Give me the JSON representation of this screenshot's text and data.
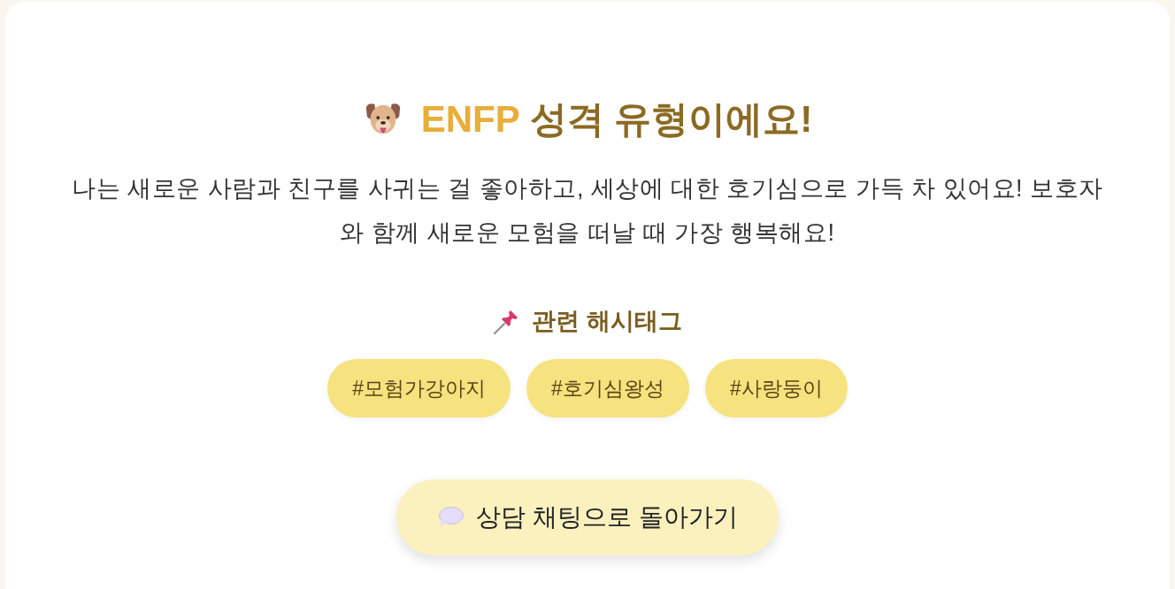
{
  "title": {
    "type_code": "ENFP",
    "text": "성격 유형이에요!"
  },
  "description": "나는 새로운 사람과 친구를 사귀는 걸 좋아하고, 세상에 대한 호기심으로 가득 차 있어요! 보호자와 함께 새로운 모험을 떠날 때 가장 행복해요!",
  "hashtags": {
    "heading": "관련 해시태그",
    "tags": [
      "#모험가강아지",
      "#호기심왕성",
      "#사랑둥이"
    ]
  },
  "back_button": {
    "label": "상담 채팅으로 돌아가기"
  }
}
